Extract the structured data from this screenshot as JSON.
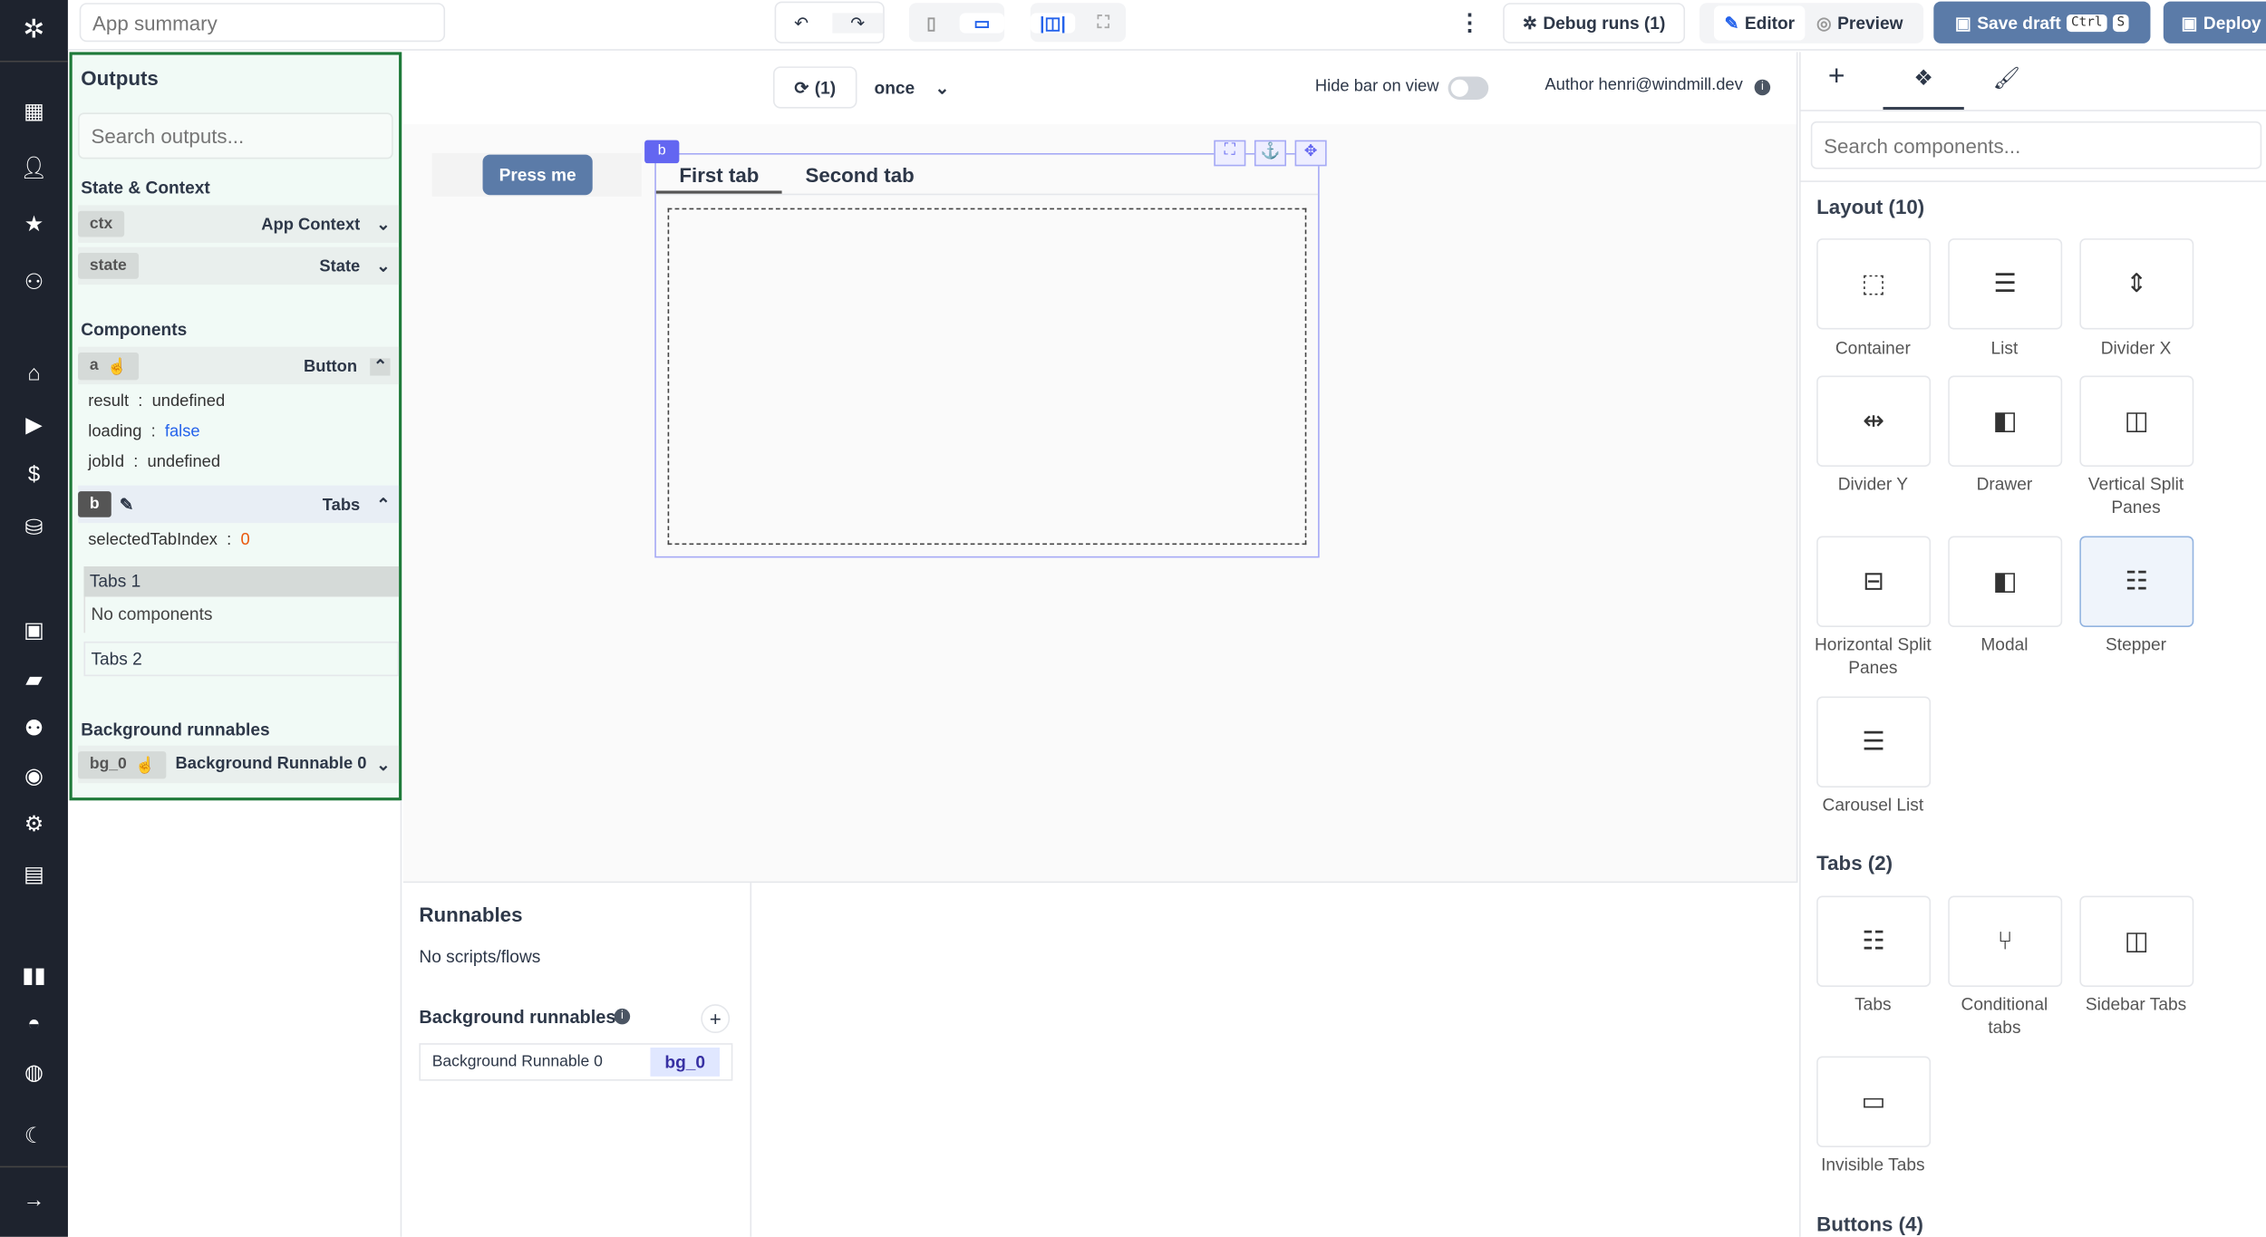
{
  "topbar": {
    "app_summary_placeholder": "App summary",
    "debug_runs": "Debug runs (1)",
    "editor": "Editor",
    "preview": "Preview",
    "save_draft": "Save draft",
    "kbd_ctrl": "Ctrl",
    "kbd_s": "S",
    "deploy": "Deploy"
  },
  "canvas_header": {
    "refresh_count": "(1)",
    "frequency": "once",
    "hide_bar": "Hide bar on view",
    "author": "Author henri@windmill.dev"
  },
  "outputs": {
    "title": "Outputs",
    "search_placeholder": "Search outputs...",
    "state_context": "State & Context",
    "ctx": {
      "id": "ctx",
      "label": "App Context"
    },
    "state": {
      "id": "state",
      "label": "State"
    },
    "components_title": "Components",
    "a": {
      "id": "a",
      "label": "Button",
      "fields": [
        {
          "k": "result",
          "v": "undefined"
        },
        {
          "k": "loading",
          "v": "false"
        },
        {
          "k": "jobId",
          "v": "undefined"
        }
      ]
    },
    "b": {
      "id": "b",
      "label": "Tabs",
      "field": {
        "k": "selectedTabIndex",
        "v": "0"
      },
      "tab1": "Tabs 1",
      "tab1_empty": "No components",
      "tab2": "Tabs 2"
    },
    "bg_title": "Background runnables",
    "bg": {
      "id": "bg_0",
      "label": "Background Runnable 0"
    }
  },
  "canvas": {
    "press_me": "Press me",
    "b_badge": "b",
    "tab1": "First tab",
    "tab2": "Second tab"
  },
  "runnables": {
    "title": "Runnables",
    "empty": "No scripts/flows",
    "bg_title": "Background runnables",
    "bg_item": "Background Runnable 0",
    "bg_id": "bg_0"
  },
  "right": {
    "search_placeholder": "Search components...",
    "layout_title": "Layout (10)",
    "layout": [
      "Container",
      "List",
      "Divider X",
      "Divider Y",
      "Drawer",
      "Vertical Split Panes",
      "Horizontal Split Panes",
      "Modal",
      "Stepper",
      "Carousel List"
    ],
    "tabs_title": "Tabs (2)",
    "tabs": [
      "Tabs",
      "Conditional tabs",
      "Sidebar Tabs",
      "Invisible Tabs"
    ],
    "buttons_title": "Buttons (4)"
  },
  "colors": {
    "sidebar": "#1e232e",
    "outputs_border": "#1f7a3a",
    "primary_button": "#5b7ba8",
    "accent": "#6366f1"
  }
}
